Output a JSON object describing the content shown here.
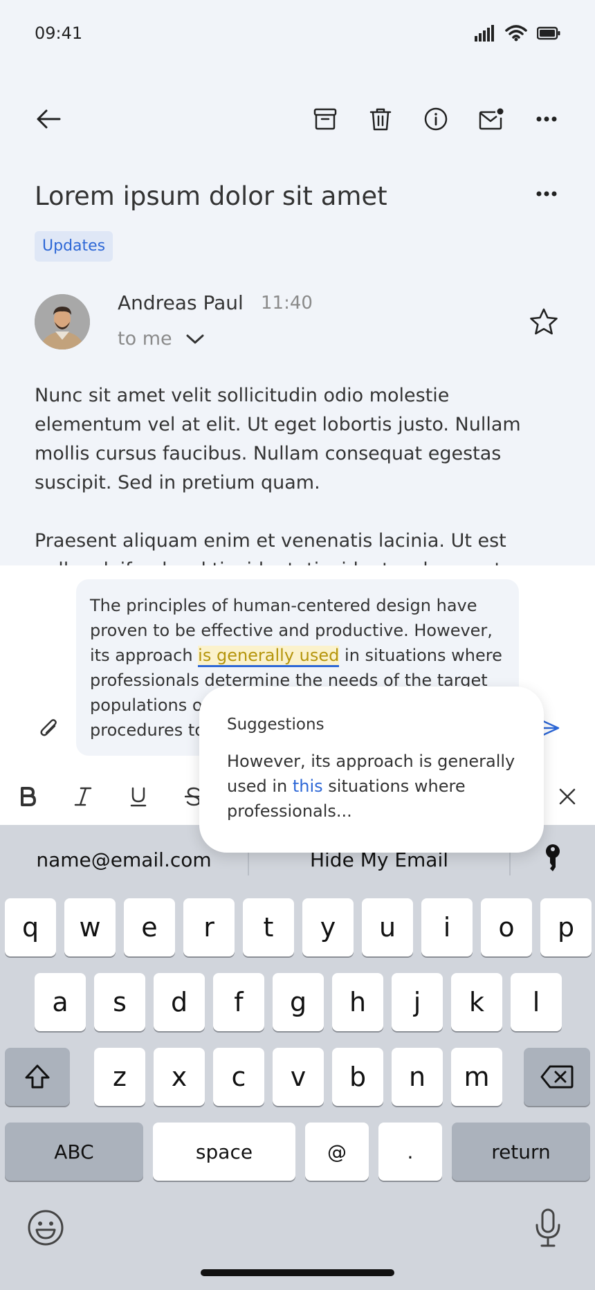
{
  "status": {
    "time": "09:41"
  },
  "email": {
    "subject": "Lorem ipsum dolor sit amet",
    "label": "Updates",
    "sender": "Andreas Paul",
    "time": "11:40",
    "recipient": "to me",
    "paragraphs": [
      "Nunc sit amet velit sollicitudin odio molestie elementum vel at elit. Ut eget lobortis justo. Nullam mollis cursus faucibus. Nullam consequat egestas suscipit. Sed in pretium quam.",
      "Praesent aliquam enim et venenatis lacinia. Ut est nulla, eleifend sed tincidunt, tincidunt ac lorem ut"
    ]
  },
  "compose": {
    "before": "The principles of human-centered design have proven to be effective and productive. However, its approach ",
    "highlight": "is generally used",
    "after": " in situations where professionals determine the needs of the target populations on their behalf and design procedures to meet those needs."
  },
  "suggestion": {
    "title": "Suggestions",
    "before": "However, its approach is generally used in ",
    "highlight": "this",
    "after": " situations where professionals..."
  },
  "keyboard": {
    "autofill": [
      "name@email.com",
      "Hide My Email"
    ],
    "row1": [
      "q",
      "w",
      "e",
      "r",
      "t",
      "y",
      "u",
      "i",
      "o",
      "p"
    ],
    "row2": [
      "a",
      "s",
      "d",
      "f",
      "g",
      "h",
      "j",
      "k",
      "l"
    ],
    "row3": [
      "z",
      "x",
      "c",
      "v",
      "b",
      "n",
      "m"
    ],
    "abc": "ABC",
    "space": "space",
    "at": "@",
    "dot": ".",
    "return": "return"
  },
  "colors": {
    "accent": "#2d67d6",
    "highlight_bg": "#fbf2cc",
    "highlight_text": "#b5950c"
  }
}
